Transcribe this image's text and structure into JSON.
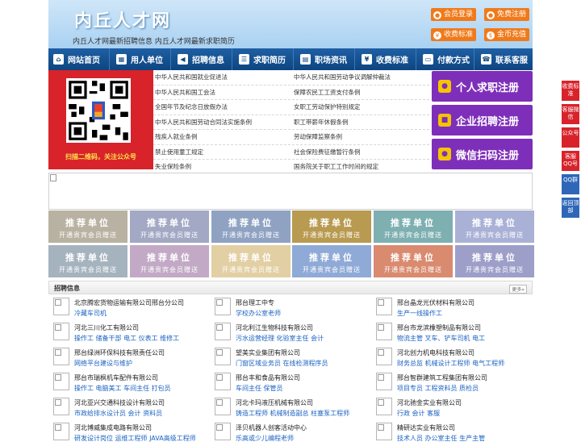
{
  "header": {
    "title": "内丘人才网",
    "subtitle": "内丘人才网最新招聘信息   内丘人才网最新求职简历",
    "buttons": [
      {
        "label": "会员登录",
        "icon": "user-icon"
      },
      {
        "label": "免费注册",
        "icon": "people-icon"
      },
      {
        "label": "收费标准",
        "icon": "yen-icon"
      },
      {
        "label": "金币充值",
        "icon": "coin-icon"
      }
    ]
  },
  "nav": {
    "items": [
      {
        "label": "网站首页",
        "icon": "home-icon"
      },
      {
        "label": "用人单位",
        "icon": "building-icon"
      },
      {
        "label": "招聘信息",
        "icon": "megaphone-icon"
      },
      {
        "label": "求职简历",
        "icon": "resume-icon"
      },
      {
        "label": "职场资讯",
        "icon": "news-icon"
      },
      {
        "label": "收费标准",
        "icon": "yen-icon"
      },
      {
        "label": "付款方式",
        "icon": "card-icon"
      },
      {
        "label": "联系客服",
        "icon": "phone-icon"
      }
    ]
  },
  "qr": {
    "caption": "扫描二维码，关注公众号"
  },
  "laws": {
    "left": [
      "中华人民共和国就业促进法",
      "中华人民共和国工会法",
      "全国年节及纪念日放假办法",
      "中华人民共和国劳动合同法实施条例",
      "残疾人就业条例",
      "禁止使用童工规定",
      "失业保险条例"
    ],
    "right": [
      "中华人民共和国劳动争议调解仲裁法",
      "保障农民工工资支付条例",
      "女职工劳动保护特别规定",
      "职工带薪年休假条例",
      "劳动保障监察条例",
      "社会保险费征缴暂行条例",
      "国务院关于职工工作时间的规定"
    ]
  },
  "register": [
    {
      "label": "个人求职注册",
      "icon": "person-icon"
    },
    {
      "label": "企业招聘注册",
      "icon": "company-icon"
    },
    {
      "label": "微信扫码注册",
      "icon": "wechat-icon"
    }
  ],
  "recommend": {
    "title": "推荐单位",
    "sub": "开通贵宾会员赠送",
    "colors": [
      "#b9b2a2",
      "#a3a8c4",
      "#8fa2c2",
      "#b89a50",
      "#7eafb1",
      "#aab1d6",
      "#a5b3bf",
      "#c2a9c5",
      "#e2cfa3",
      "#8faad6",
      "#d98a6f",
      "#9d9fc9"
    ]
  },
  "jobs": {
    "heading": "招聘信息",
    "more": "更多»",
    "items": [
      {
        "company": "北京腾宏货物运输有限公司邢台分公司",
        "positions": "冷藏车司机"
      },
      {
        "company": "邢台理工中专",
        "positions": "学校办公室老师"
      },
      {
        "company": "邢台晶龙光伏材料有限公司",
        "positions": "生产一线操作工"
      },
      {
        "company": "河北三川化工有限公司",
        "positions": "操作工  储备干部  电工  仪表工  维修工"
      },
      {
        "company": "河北利江生物科技有限公司",
        "positions": "污水运营经理  化验室主任  会计"
      },
      {
        "company": "邢台市龙滨橡塑制品有限公司",
        "positions": "物流主管  叉车、铲车司机  电工"
      },
      {
        "company": "邢台绿洲环保科技有限责任公司",
        "positions": "网络平台建设与维护"
      },
      {
        "company": "望美实业集团有限公司",
        "positions": "门窗区域业务员  在线检测程序员"
      },
      {
        "company": "河北创力机电科技有限公司",
        "positions": "财务总监  机械设计工程师  电气工程师"
      },
      {
        "company": "邢台市瑞枫机车配件有限公司",
        "positions": "操作工  电脑美工  车间主任  打包员"
      },
      {
        "company": "邢台丰和食品有限公司",
        "positions": "车间主任  保管员"
      },
      {
        "company": "邢台智群建筑工程集团有限公司",
        "positions": "项目专员  工程资料员  质检员"
      },
      {
        "company": "河北亚兴交通科技设计有限公司",
        "positions": "市政给排水设计员  会计  资料员"
      },
      {
        "company": "河北卡玛液压机械有限公司",
        "positions": "铸造工程师  机械制造副总  柱塞泵工程师"
      },
      {
        "company": "河北驰金实业有限公司",
        "positions": "行政  会计  客服"
      },
      {
        "company": "河北博威集成电路有限公司",
        "positions": "研发设计岗位  运维工程师  JAVA高级工程师"
      },
      {
        "company": "泽贝机器人创客活动中心",
        "positions": "乐高或少儿编程老师"
      },
      {
        "company": "精研达实业有限公司",
        "positions": "技术人员  办公室主任  生产主管"
      }
    ]
  },
  "float": [
    {
      "label": "收费标准"
    },
    {
      "label": "客服微信"
    },
    {
      "label": "公众号"
    },
    {
      "label": "客服QQ号"
    },
    {
      "label": "QQ群"
    },
    {
      "label": "返回顶部"
    }
  ]
}
